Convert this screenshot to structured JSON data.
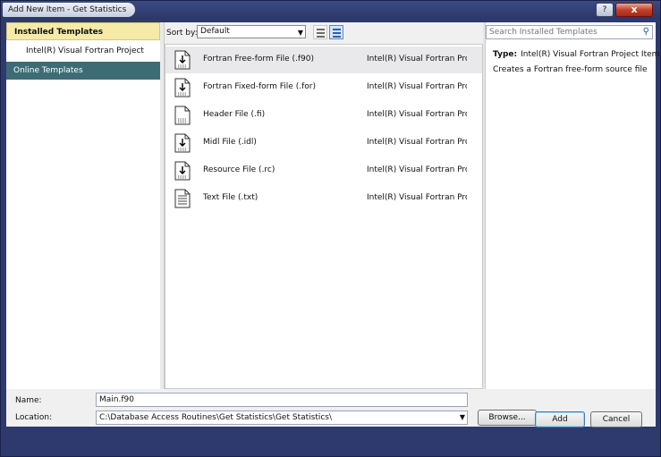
{
  "window": {
    "title": "Add New Item - Get Statistics",
    "help_label": "?",
    "close_label": "x"
  },
  "left_nav": {
    "installed_label": "Installed Templates",
    "intel_label": "Intel(R) Visual Fortran Project Items",
    "online_label": "Online Templates"
  },
  "toolbar": {
    "sort_label": "Sort by:",
    "sort_value": "Default"
  },
  "items": [
    {
      "name": "Fortran Free-form File (.f90)",
      "type": "Intel(R) Visual Fortran Project Items",
      "icon": "fortran-file-icon"
    },
    {
      "name": "Fortran Fixed-form File (.for)",
      "type": "Intel(R) Visual Fortran Project Items",
      "icon": "fortran-file-icon"
    },
    {
      "name": "Header File (.fi)",
      "type": "Intel(R) Visual Fortran Project Items",
      "icon": "header-file-icon"
    },
    {
      "name": "Midl File (.idl)",
      "type": "Intel(R) Visual Fortran Project Items",
      "icon": "fortran-file-icon"
    },
    {
      "name": "Resource File (.rc)",
      "type": "Intel(R) Visual Fortran Project Items",
      "icon": "fortran-file-icon"
    },
    {
      "name": "Text File (.txt)",
      "type": "Intel(R) Visual Fortran Project Items",
      "icon": "text-file-icon"
    }
  ],
  "search": {
    "placeholder": "Search Installed Templates"
  },
  "details": {
    "type_label": "Type:",
    "type_value": "Intel(R) Visual Fortran Project Items",
    "description": "Creates a Fortran free-form source file"
  },
  "form": {
    "name_label": "Name:",
    "name_value": "Main.f90",
    "location_label": "Location:",
    "location_value": "C:\\Database Access Routines\\Get Statistics\\Get Statistics\\"
  },
  "buttons": {
    "browse_label": "Browse...",
    "add_label": "Add",
    "cancel_label": "Cancel"
  }
}
